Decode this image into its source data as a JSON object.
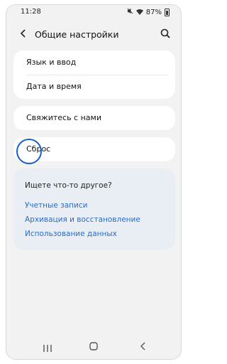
{
  "status_bar": {
    "time": "11:28",
    "battery_percent": "87%",
    "icons": [
      "mute-icon",
      "wifi-icon",
      "battery-icon"
    ]
  },
  "app_bar": {
    "title": "Общие настройки",
    "back_icon": "back-arrow-icon",
    "search_icon": "search-icon"
  },
  "settings_groups": [
    {
      "items": [
        {
          "label": "Язык и ввод"
        },
        {
          "label": "Дата и время"
        }
      ]
    },
    {
      "items": [
        {
          "label": "Свяжитесь с нами"
        }
      ]
    },
    {
      "items": [
        {
          "label": "Сброс"
        }
      ]
    }
  ],
  "suggestions": {
    "heading": "Ищете что-то другое?",
    "links": [
      {
        "label": "Учетные записи"
      },
      {
        "label": "Архивация и восстановление"
      },
      {
        "label": "Использование данных"
      }
    ]
  },
  "nav_bar": {
    "icons": [
      "recent-apps-icon",
      "home-icon",
      "back-icon"
    ]
  },
  "colors": {
    "background": "#f2f2f2",
    "card": "#ffffff",
    "suggest_bg": "#e9eef4",
    "link": "#2b6cc4",
    "highlight_ring": "#1a5fc7"
  }
}
